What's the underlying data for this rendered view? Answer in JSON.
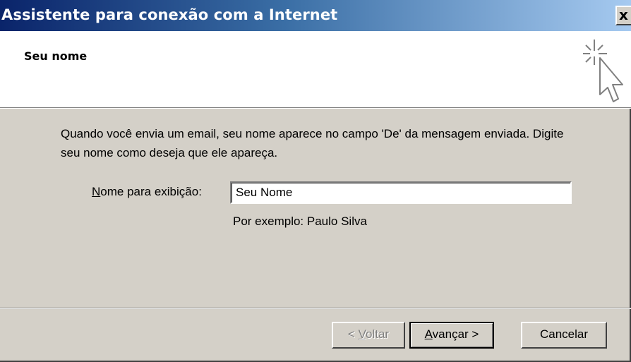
{
  "window": {
    "title": "Assistente para conexão com a Internet",
    "close_glyph": "x"
  },
  "header": {
    "title": "Seu nome",
    "icon": "wizard-cursor-sparkle-icon"
  },
  "content": {
    "description": "Quando você envia um email, seu nome aparece no campo 'De' da mensagem enviada. Digite seu nome como deseja que ele apareça.",
    "field": {
      "label_accel": "N",
      "label_rest": "ome para exibição:",
      "value": "Seu Nome",
      "example": "Por exemplo: Paulo Silva"
    }
  },
  "buttons": {
    "back_prefix": "< ",
    "back_accel": "V",
    "back_rest": "oltar",
    "next_accel": "A",
    "next_rest": "vançar >",
    "cancel": "Cancelar"
  },
  "colors": {
    "face": "#d4d0c8",
    "title_start": "#0a246a",
    "title_end": "#a6caf0"
  }
}
